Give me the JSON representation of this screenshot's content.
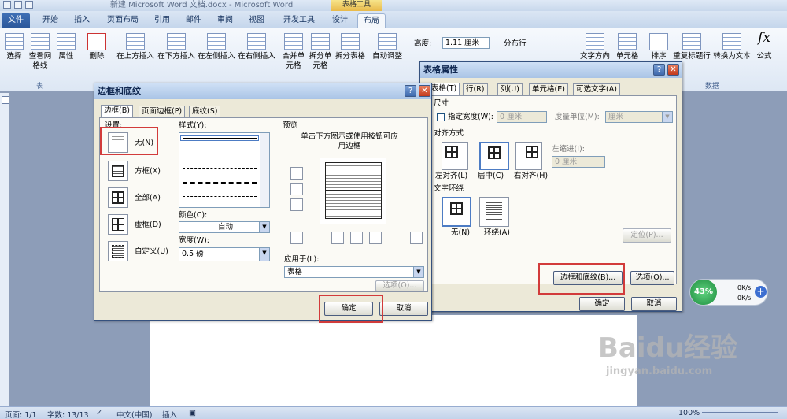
{
  "window": {
    "title": "新建 Microsoft Word 文档.docx - Microsoft Word",
    "context_tab_group": "表格工具"
  },
  "tabs": [
    "文件",
    "开始",
    "插入",
    "页面布局",
    "引用",
    "邮件",
    "审阅",
    "视图",
    "开发工具",
    "设计",
    "布局"
  ],
  "ribbon": {
    "buttons": [
      "选择",
      "查看网格线",
      "属性",
      "删除",
      "在上方插入",
      "在下方插入",
      "在左侧插入",
      "在右侧插入",
      "合并单元格",
      "拆分单元格",
      "拆分表格",
      "自动调整",
      "文字方向",
      "单元格",
      "排序",
      "重复标题行",
      "转换为文本",
      "公式"
    ],
    "height_label": "高度:",
    "height_value": "1.11 厘米",
    "distribute_rows": "分布行",
    "group_table": "表",
    "group_data": "数据"
  },
  "border_dialog": {
    "title": "边框和底纹",
    "tabs": [
      "边框(B)",
      "页面边框(P)",
      "底纹(S)"
    ],
    "setting_label": "设置:",
    "settings": [
      "无(N)",
      "方框(X)",
      "全部(A)",
      "虚框(D)",
      "自定义(U)"
    ],
    "style_label": "样式(Y):",
    "color_label": "颜色(C):",
    "color_value": "自动",
    "width_label": "宽度(W):",
    "width_value": "0.5 磅",
    "preview_label": "预览",
    "preview_hint": "单击下方图示或使用按钮可应用边框",
    "apply_label": "应用于(L):",
    "apply_value": "表格",
    "options_button": "选项(O)...",
    "ok_button": "确定",
    "cancel_button": "取消"
  },
  "table_props": {
    "title": "表格属性",
    "tabs": [
      "表格(T)",
      "行(R)",
      "列(U)",
      "单元格(E)",
      "可选文字(A)"
    ],
    "size_label": "尺寸",
    "pref_width_label": "指定宽度(W):",
    "pref_width_value": "0 厘米",
    "measure_label": "度量单位(M):",
    "measure_value": "厘米",
    "align_label": "对齐方式",
    "aligns": [
      "左对齐(L)",
      "居中(C)",
      "右对齐(H)"
    ],
    "indent_label": "左缩进(I):",
    "indent_value": "0 厘米",
    "wrap_label": "文字环绕",
    "wraps": [
      "无(N)",
      "环绕(A)"
    ],
    "position_button": "定位(P)...",
    "borders_button": "边框和底纹(B)...",
    "options_button": "选项(O)...",
    "ok_button": "确定",
    "cancel_button": "取消"
  },
  "speed_widget": {
    "percent": "43%",
    "up": "0K/s",
    "down": "0K/s"
  },
  "status": {
    "page": "页面: 1/1",
    "words": "字数: 13/13",
    "lang": "中文(中国)",
    "insert": "插入",
    "zoom": "100%"
  },
  "watermark": {
    "brand": "Baidu经验",
    "url": "jingyan.baidu.com"
  }
}
